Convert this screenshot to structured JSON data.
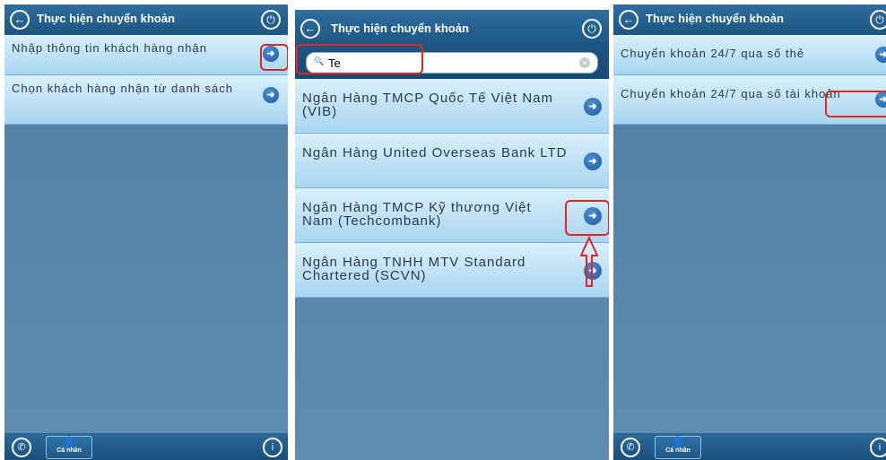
{
  "screen_title": "Thực hiện chuyển khoản",
  "icons": {
    "back": "←",
    "power": "⏻",
    "arrow": "➜",
    "phone": "✆",
    "info": "i",
    "search": "🔍",
    "person": "👤"
  },
  "footer": {
    "personal_label": "Cá nhân"
  },
  "panel1": {
    "items": [
      {
        "label": "Nhập thông tin khách hàng nhận"
      },
      {
        "label": "Chọn khách hàng nhận từ danh sách"
      }
    ]
  },
  "panel2": {
    "search_value": "Te",
    "banks": [
      {
        "label": "Ngân Hàng TMCP Quốc Tế Việt Nam (VIB)"
      },
      {
        "label": "Ngân Hàng United Overseas Bank LTD"
      },
      {
        "label": "Ngân Hàng TMCP Kỹ thương Việt Nam (Techcombank)"
      },
      {
        "label": "Ngân Hàng TNHH MTV Standard Chartered (SCVN)"
      }
    ]
  },
  "panel3": {
    "items": [
      {
        "label": "Chuyển khoản 24/7 qua số thẻ"
      },
      {
        "label": "Chuyển khoản 24/7 qua số tài khoản"
      }
    ]
  },
  "colors": {
    "header": "#1f5b8a",
    "row": "#bfe3f8",
    "highlight": "#e0261e",
    "body": "#5a88ad"
  }
}
